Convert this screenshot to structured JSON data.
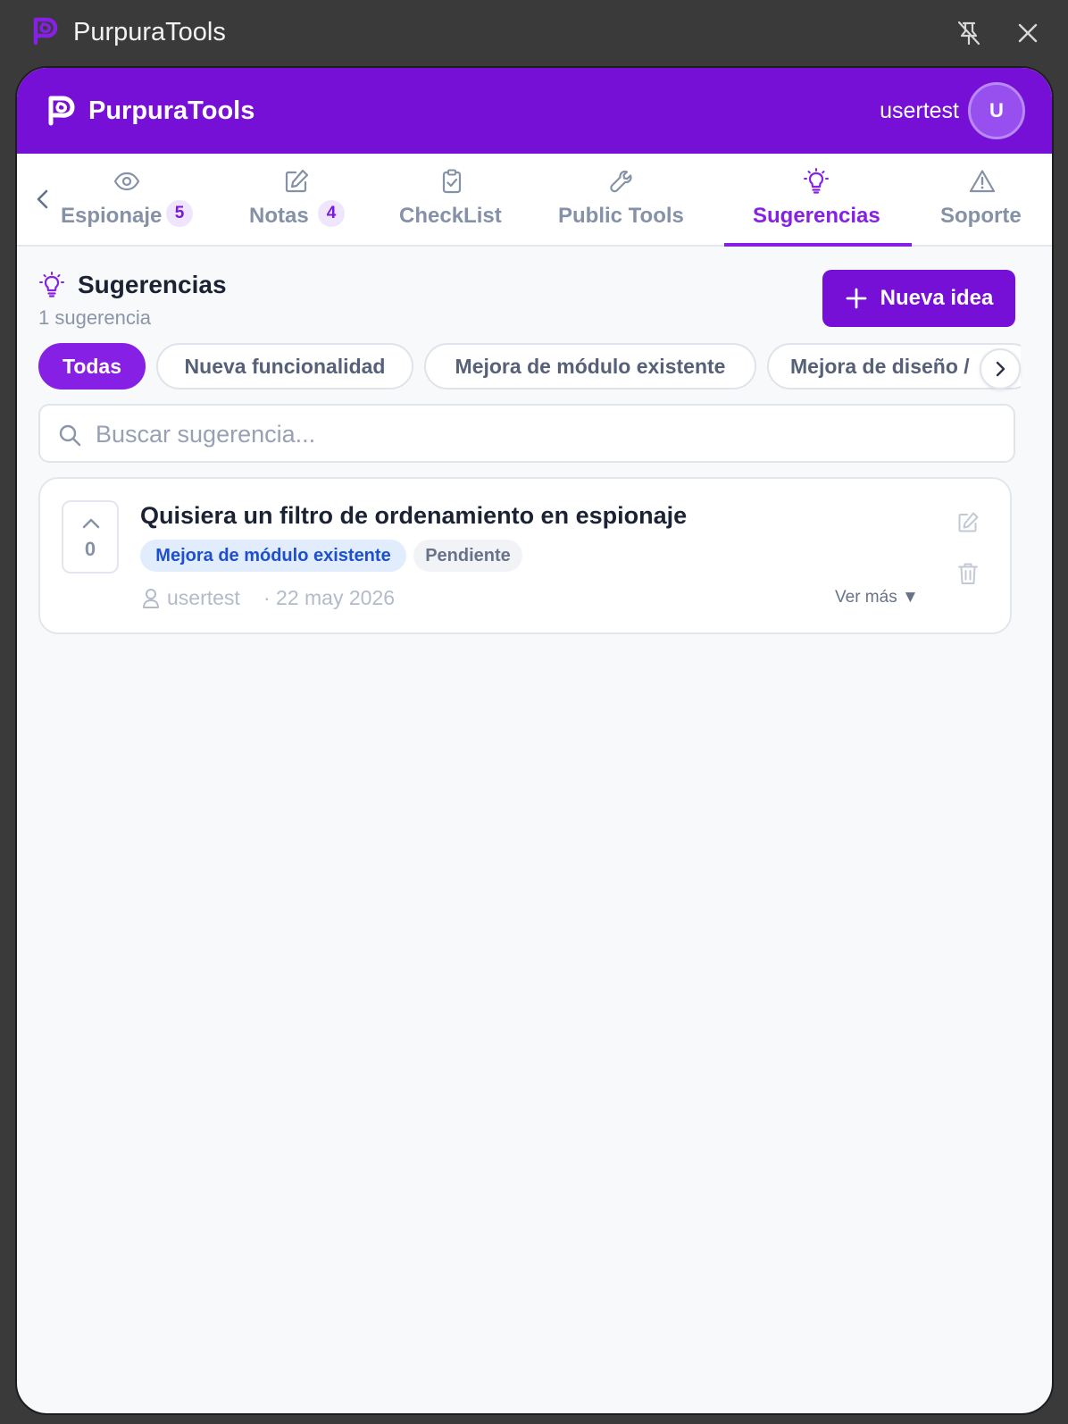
{
  "window": {
    "title": "PurpuraTools"
  },
  "header": {
    "brand": "PurpuraTools",
    "username": "usertest",
    "avatar_initial": "U"
  },
  "tabs": [
    {
      "label": "Espionaje",
      "badge": "5",
      "icon": "eye-icon"
    },
    {
      "label": "Notas",
      "badge": "4",
      "icon": "edit-icon"
    },
    {
      "label": "CheckList",
      "icon": "clipboard-check-icon"
    },
    {
      "label": "Public Tools",
      "icon": "wrench-icon"
    },
    {
      "label": "Sugerencias",
      "icon": "lightbulb-icon",
      "active": true
    },
    {
      "label": "Soporte",
      "icon": "warning-icon"
    }
  ],
  "section": {
    "title": "Sugerencias",
    "count": "1 sugerencia",
    "new_button": "Nueva idea"
  },
  "filters": [
    {
      "label": "Todas",
      "active": true
    },
    {
      "label": "Nueva funcionalidad"
    },
    {
      "label": "Mejora de módulo existente"
    },
    {
      "label": "Mejora de diseño / "
    }
  ],
  "search": {
    "placeholder": "Buscar sugerencia...",
    "value": ""
  },
  "suggestions": [
    {
      "title": "Quisiera un filtro de ordenamiento en espionaje",
      "votes": "0",
      "category": "Mejora de módulo existente",
      "status": "Pendiente",
      "author": "usertest",
      "date": "· 22 may 2026",
      "more": "Ver más ▼"
    }
  ],
  "colors": {
    "brand": "#7710d6",
    "accent": "#8620e4",
    "tab_inactive": "#8591a7",
    "category_tag_bg": "#e1ecfd",
    "category_tag_text": "#1d4fd0"
  }
}
